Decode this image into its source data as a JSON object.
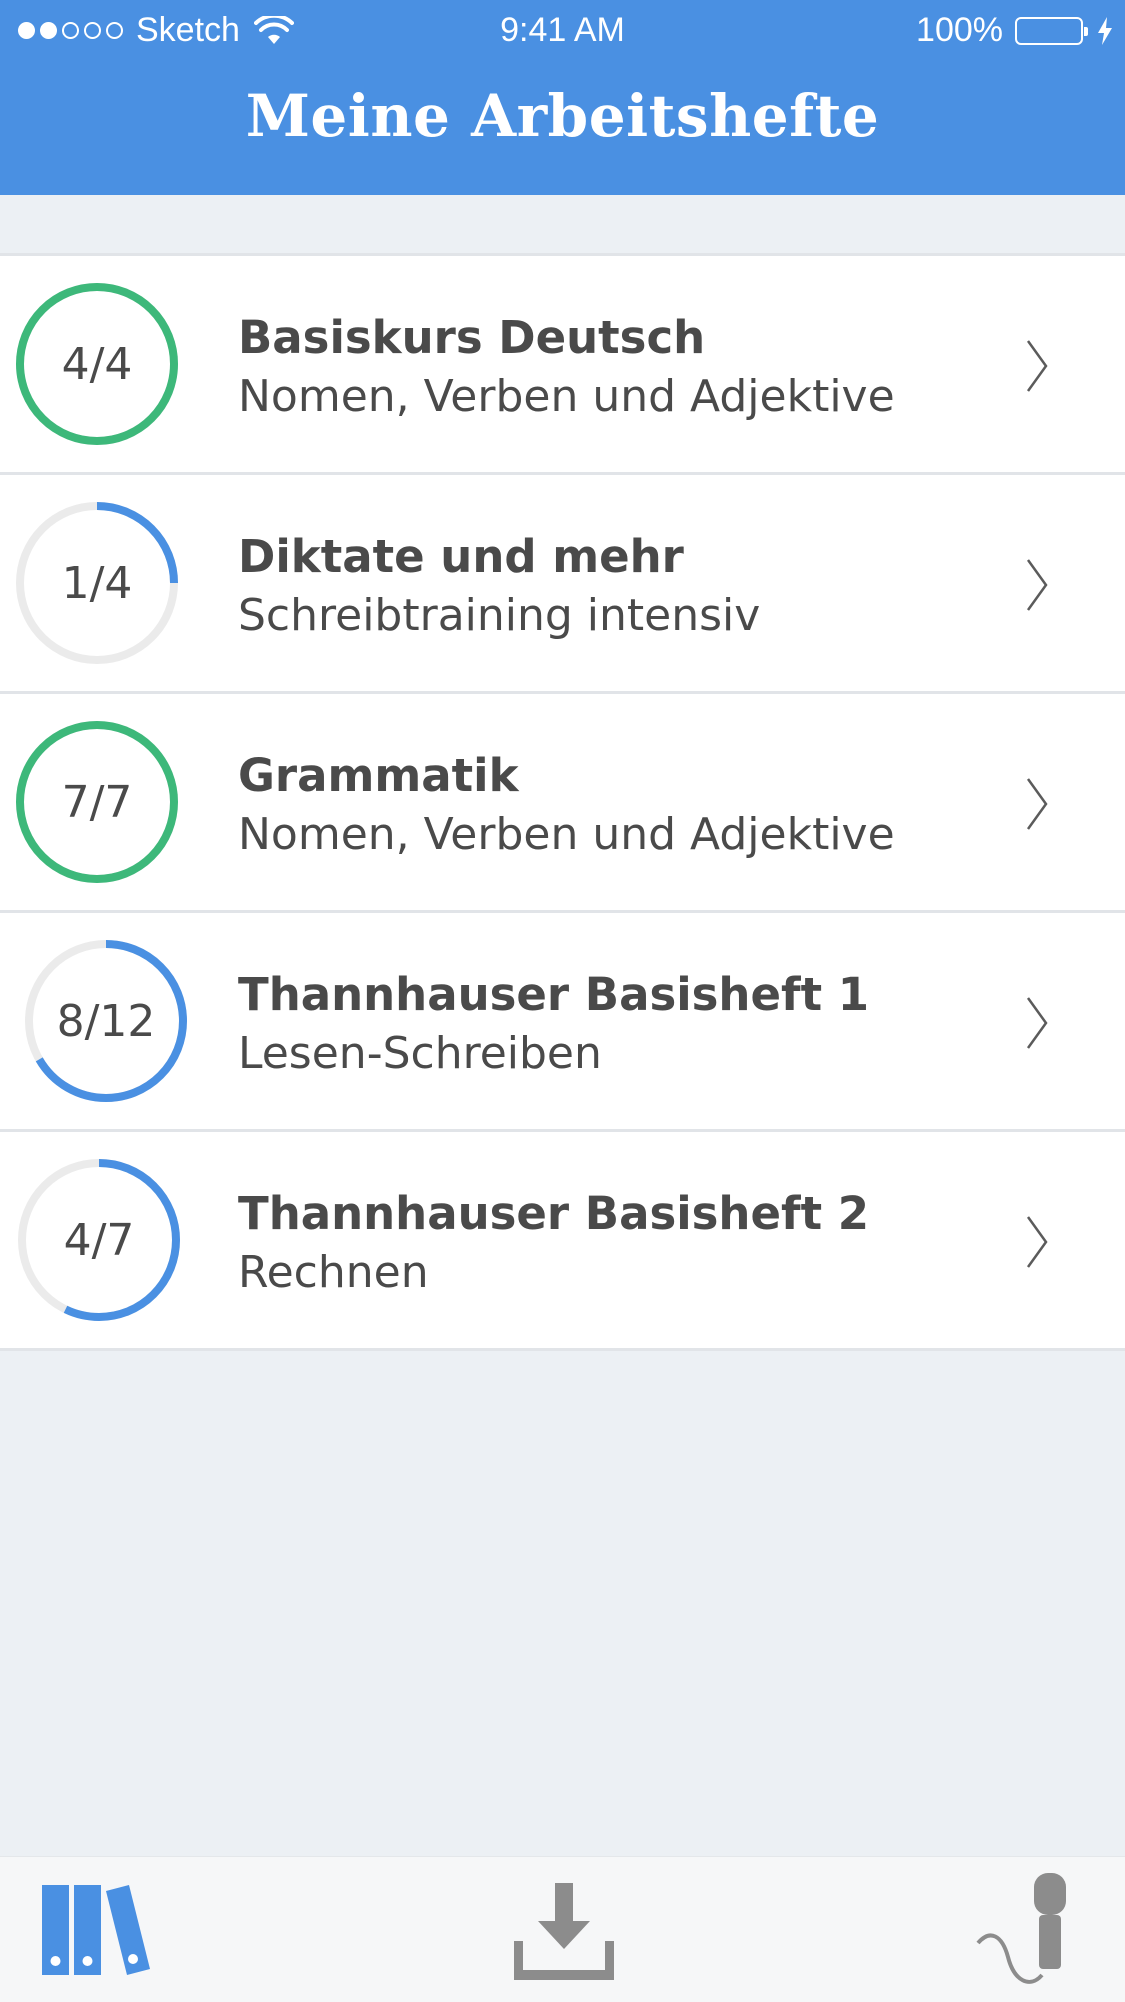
{
  "status_bar": {
    "carrier": "Sketch",
    "time": "9:41 AM",
    "battery": "100%"
  },
  "header": {
    "title": "Meine Arbeitshefte"
  },
  "colors": {
    "header": "#4A90E2",
    "complete": "#3DB87A",
    "in_progress": "#4A90E2",
    "track": "#EBEBEB",
    "text": "#4A4A4A",
    "background": "#ECF0F4"
  },
  "workbooks": [
    {
      "title": "Basiskurs Deutsch",
      "subtitle": "Nomen, Verben und Adjektive",
      "progress": "4/4",
      "done": 4,
      "total": 4
    },
    {
      "title": "Diktate und mehr",
      "subtitle": "Schreibtraining intensiv",
      "progress": "1/4",
      "done": 1,
      "total": 4
    },
    {
      "title": "Grammatik",
      "subtitle": "Nomen, Verben und Adjektive",
      "progress": "7/7",
      "done": 7,
      "total": 7
    },
    {
      "title": "Thannhauser Basisheft 1",
      "subtitle": "Lesen-Schreiben",
      "progress": "8/12",
      "done": 8,
      "total": 12
    },
    {
      "title": "Thannhauser Basisheft 2",
      "subtitle": "Rechnen",
      "progress": "4/7",
      "done": 4,
      "total": 7
    }
  ],
  "tab_bar": {
    "tabs": [
      {
        "icon": "library-icon",
        "active": true
      },
      {
        "icon": "download-icon",
        "active": false
      },
      {
        "icon": "microphone-icon",
        "active": false
      }
    ]
  }
}
